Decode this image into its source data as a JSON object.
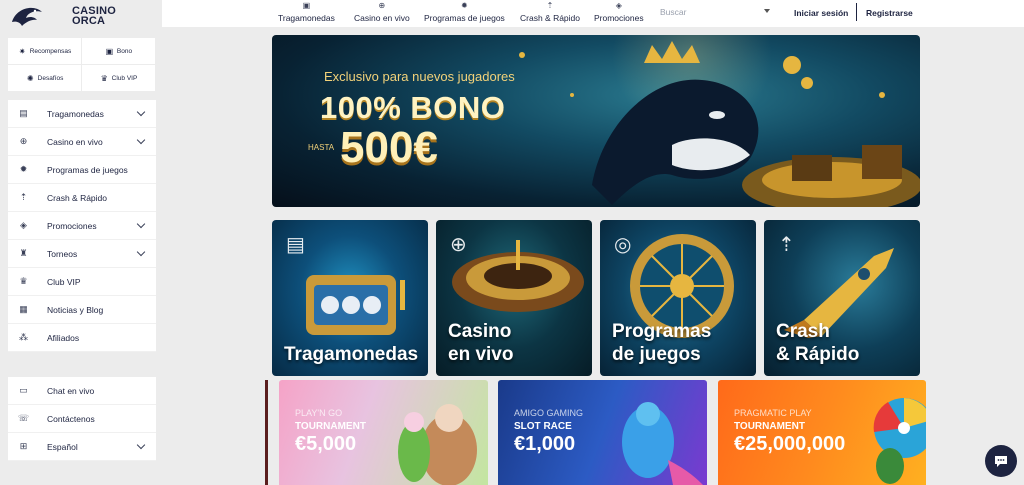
{
  "brand": {
    "line1": "CASINO",
    "line2": "ORCA"
  },
  "quick_links": [
    {
      "label": "Recompensas",
      "icon": "star-burst-icon"
    },
    {
      "label": "Bono",
      "icon": "gift-icon"
    },
    {
      "label": "Desafíos",
      "icon": "challenge-icon"
    },
    {
      "label": "Club VIP",
      "icon": "crown-icon"
    }
  ],
  "sidebar": {
    "items": [
      {
        "label": "Tragamonedas",
        "icon": "slot-icon",
        "has_chevron": true
      },
      {
        "label": "Casino en vivo",
        "icon": "roulette-icon",
        "has_chevron": true
      },
      {
        "label": "Programas de juegos",
        "icon": "wheel-icon",
        "has_chevron": false
      },
      {
        "label": "Crash & Rápido",
        "icon": "rocket-icon",
        "has_chevron": false
      },
      {
        "label": "Promociones",
        "icon": "tag-icon",
        "has_chevron": true
      },
      {
        "label": "Torneos",
        "icon": "trophy-icon",
        "has_chevron": true
      },
      {
        "label": "Club VIP",
        "icon": "crown-icon",
        "has_chevron": false
      },
      {
        "label": "Noticias y Blog",
        "icon": "news-icon",
        "has_chevron": false
      },
      {
        "label": "Afiliados",
        "icon": "affiliates-icon",
        "has_chevron": false
      }
    ],
    "bottom_items": [
      {
        "label": "Chat en vivo",
        "icon": "chat-icon",
        "has_chevron": false
      },
      {
        "label": "Contáctenos",
        "icon": "contact-icon",
        "has_chevron": false
      },
      {
        "label": "Español",
        "icon": "language-icon",
        "has_chevron": true
      }
    ]
  },
  "header": {
    "nav": [
      {
        "label": "Tragamonedas",
        "icon": "slot-icon"
      },
      {
        "label": "Casino en vivo",
        "icon": "roulette-icon"
      },
      {
        "label": "Programas de juegos",
        "icon": "wheel-icon"
      },
      {
        "label": "Crash & Rápido",
        "icon": "rocket-icon"
      },
      {
        "label": "Promociones",
        "icon": "tag-icon"
      }
    ],
    "search_placeholder": "Buscar",
    "login_label": "Iniciar sesión",
    "register_label": "Registrarse"
  },
  "hero": {
    "subtitle": "Exclusivo para nuevos jugadores",
    "bonus": "100% BONO",
    "up_to": "HASTA",
    "amount": "500€"
  },
  "categories": [
    {
      "line1": "Tragamonedas",
      "line2": ""
    },
    {
      "line1": "Casino",
      "line2": "en vivo"
    },
    {
      "line1": "Programas",
      "line2": "de juegos"
    },
    {
      "line1": "Crash",
      "line2": "& Rápido"
    }
  ],
  "tournaments": [
    {
      "provider": "PLAY'N GO",
      "kind": "TOURNAMENT",
      "amount": "€5,000"
    },
    {
      "provider": "AMIGO GAMING",
      "kind": "SLOT RACE",
      "amount": "€1,000"
    },
    {
      "provider": "PRAGMATIC PLAY",
      "kind": "TOURNAMENT",
      "amount": "€25,000,000"
    }
  ],
  "colors": {
    "brand_navy": "#1d2340",
    "page_bg": "#ececec",
    "gold": "#f2d27a"
  }
}
